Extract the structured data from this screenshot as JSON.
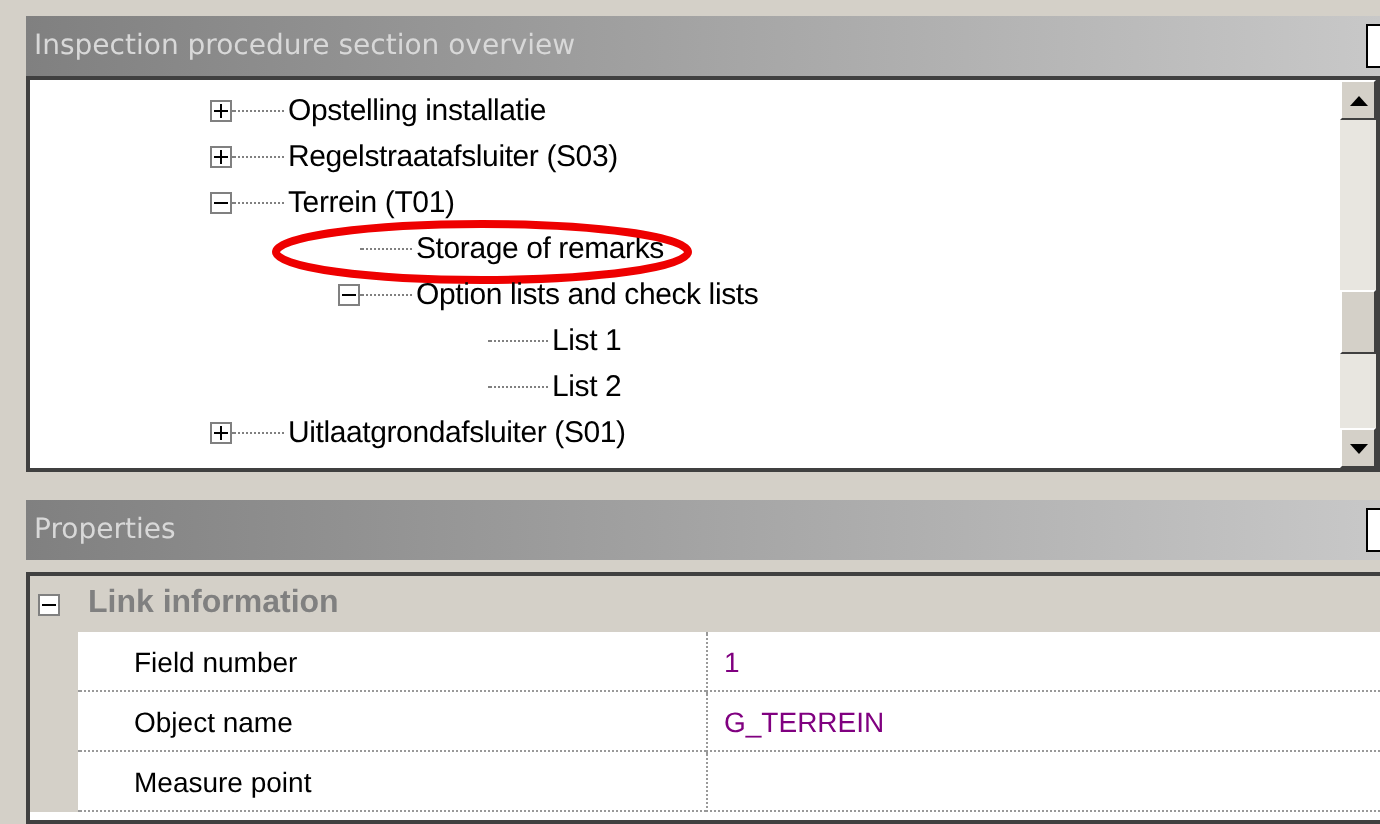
{
  "tree_panel": {
    "title": "Inspection procedure section overview",
    "items": [
      {
        "label": "Opstelling installatie",
        "expanded": false
      },
      {
        "label": "Regelstraatafsluiter (S03)",
        "expanded": false
      },
      {
        "label": "Terrein (T01)",
        "expanded": true,
        "children": [
          {
            "label": "Storage of remarks",
            "highlighted": true
          },
          {
            "label": "Option lists and check lists",
            "expanded": true,
            "children": [
              {
                "label": "List 1"
              },
              {
                "label": "List 2"
              }
            ]
          }
        ]
      },
      {
        "label": "Uitlaatgrondafsluiter (S01)",
        "expanded": false
      }
    ]
  },
  "properties_panel": {
    "title": "Properties",
    "category": {
      "label": "Link information",
      "expanded": true
    },
    "rows": [
      {
        "name": "Field number",
        "value": "1"
      },
      {
        "name": "Object name",
        "value": "G_TERREIN"
      },
      {
        "name": "Measure point",
        "value": ""
      }
    ]
  }
}
